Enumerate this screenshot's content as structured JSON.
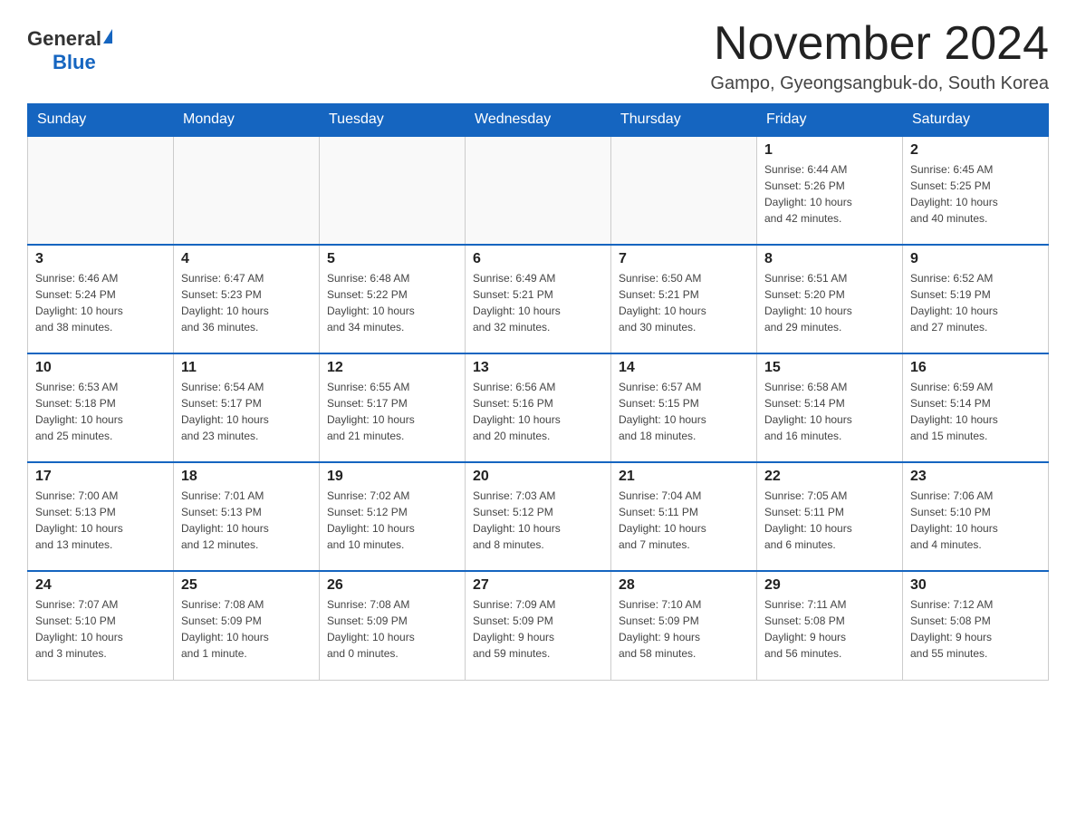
{
  "header": {
    "logo_general": "General",
    "logo_blue": "Blue",
    "month_title": "November 2024",
    "location": "Gampo, Gyeongsangbuk-do, South Korea"
  },
  "weekdays": [
    "Sunday",
    "Monday",
    "Tuesday",
    "Wednesday",
    "Thursday",
    "Friday",
    "Saturday"
  ],
  "weeks": [
    [
      {
        "day": "",
        "info": ""
      },
      {
        "day": "",
        "info": ""
      },
      {
        "day": "",
        "info": ""
      },
      {
        "day": "",
        "info": ""
      },
      {
        "day": "",
        "info": ""
      },
      {
        "day": "1",
        "info": "Sunrise: 6:44 AM\nSunset: 5:26 PM\nDaylight: 10 hours\nand 42 minutes."
      },
      {
        "day": "2",
        "info": "Sunrise: 6:45 AM\nSunset: 5:25 PM\nDaylight: 10 hours\nand 40 minutes."
      }
    ],
    [
      {
        "day": "3",
        "info": "Sunrise: 6:46 AM\nSunset: 5:24 PM\nDaylight: 10 hours\nand 38 minutes."
      },
      {
        "day": "4",
        "info": "Sunrise: 6:47 AM\nSunset: 5:23 PM\nDaylight: 10 hours\nand 36 minutes."
      },
      {
        "day": "5",
        "info": "Sunrise: 6:48 AM\nSunset: 5:22 PM\nDaylight: 10 hours\nand 34 minutes."
      },
      {
        "day": "6",
        "info": "Sunrise: 6:49 AM\nSunset: 5:21 PM\nDaylight: 10 hours\nand 32 minutes."
      },
      {
        "day": "7",
        "info": "Sunrise: 6:50 AM\nSunset: 5:21 PM\nDaylight: 10 hours\nand 30 minutes."
      },
      {
        "day": "8",
        "info": "Sunrise: 6:51 AM\nSunset: 5:20 PM\nDaylight: 10 hours\nand 29 minutes."
      },
      {
        "day": "9",
        "info": "Sunrise: 6:52 AM\nSunset: 5:19 PM\nDaylight: 10 hours\nand 27 minutes."
      }
    ],
    [
      {
        "day": "10",
        "info": "Sunrise: 6:53 AM\nSunset: 5:18 PM\nDaylight: 10 hours\nand 25 minutes."
      },
      {
        "day": "11",
        "info": "Sunrise: 6:54 AM\nSunset: 5:17 PM\nDaylight: 10 hours\nand 23 minutes."
      },
      {
        "day": "12",
        "info": "Sunrise: 6:55 AM\nSunset: 5:17 PM\nDaylight: 10 hours\nand 21 minutes."
      },
      {
        "day": "13",
        "info": "Sunrise: 6:56 AM\nSunset: 5:16 PM\nDaylight: 10 hours\nand 20 minutes."
      },
      {
        "day": "14",
        "info": "Sunrise: 6:57 AM\nSunset: 5:15 PM\nDaylight: 10 hours\nand 18 minutes."
      },
      {
        "day": "15",
        "info": "Sunrise: 6:58 AM\nSunset: 5:14 PM\nDaylight: 10 hours\nand 16 minutes."
      },
      {
        "day": "16",
        "info": "Sunrise: 6:59 AM\nSunset: 5:14 PM\nDaylight: 10 hours\nand 15 minutes."
      }
    ],
    [
      {
        "day": "17",
        "info": "Sunrise: 7:00 AM\nSunset: 5:13 PM\nDaylight: 10 hours\nand 13 minutes."
      },
      {
        "day": "18",
        "info": "Sunrise: 7:01 AM\nSunset: 5:13 PM\nDaylight: 10 hours\nand 12 minutes."
      },
      {
        "day": "19",
        "info": "Sunrise: 7:02 AM\nSunset: 5:12 PM\nDaylight: 10 hours\nand 10 minutes."
      },
      {
        "day": "20",
        "info": "Sunrise: 7:03 AM\nSunset: 5:12 PM\nDaylight: 10 hours\nand 8 minutes."
      },
      {
        "day": "21",
        "info": "Sunrise: 7:04 AM\nSunset: 5:11 PM\nDaylight: 10 hours\nand 7 minutes."
      },
      {
        "day": "22",
        "info": "Sunrise: 7:05 AM\nSunset: 5:11 PM\nDaylight: 10 hours\nand 6 minutes."
      },
      {
        "day": "23",
        "info": "Sunrise: 7:06 AM\nSunset: 5:10 PM\nDaylight: 10 hours\nand 4 minutes."
      }
    ],
    [
      {
        "day": "24",
        "info": "Sunrise: 7:07 AM\nSunset: 5:10 PM\nDaylight: 10 hours\nand 3 minutes."
      },
      {
        "day": "25",
        "info": "Sunrise: 7:08 AM\nSunset: 5:09 PM\nDaylight: 10 hours\nand 1 minute."
      },
      {
        "day": "26",
        "info": "Sunrise: 7:08 AM\nSunset: 5:09 PM\nDaylight: 10 hours\nand 0 minutes."
      },
      {
        "day": "27",
        "info": "Sunrise: 7:09 AM\nSunset: 5:09 PM\nDaylight: 9 hours\nand 59 minutes."
      },
      {
        "day": "28",
        "info": "Sunrise: 7:10 AM\nSunset: 5:09 PM\nDaylight: 9 hours\nand 58 minutes."
      },
      {
        "day": "29",
        "info": "Sunrise: 7:11 AM\nSunset: 5:08 PM\nDaylight: 9 hours\nand 56 minutes."
      },
      {
        "day": "30",
        "info": "Sunrise: 7:12 AM\nSunset: 5:08 PM\nDaylight: 9 hours\nand 55 minutes."
      }
    ]
  ]
}
